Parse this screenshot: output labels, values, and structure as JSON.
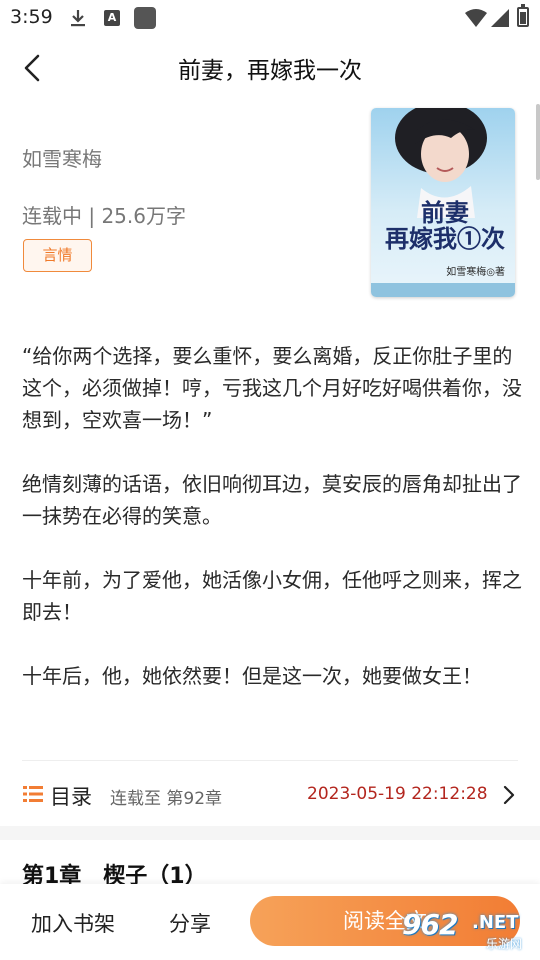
{
  "status_bar": {
    "time": "3:59",
    "icons": [
      "download-icon",
      "a-notification-icon",
      "app-square-icon",
      "wifi-icon",
      "signal-icon",
      "battery-icon"
    ]
  },
  "header": {
    "title": "前妻，再嫁我一次",
    "back_icon": "chevron-left-icon"
  },
  "book": {
    "author": "如雪寒梅",
    "status_line": "连载中 | 25.6万字",
    "genre_tag": "言情",
    "cover": {
      "title_line1": "前妻",
      "title_line2": "再嫁我①次",
      "author_credit": "如雪寒梅◎著"
    }
  },
  "synopsis": [
    "“给你两个选择，要么重怀，要么离婚，反正你肚子里的这个，必须做掉！哼，亏我这几个月好吃好喝供着你，没想到，空欢喜一场！”",
    "绝情刻薄的话语，依旧响彻耳边，莫安辰的唇角却扯出了一抹势在必得的笑意。",
    "十年前，为了爱他，她活像小女佣，任他呼之则来，挥之即去！",
    "十年后，他，她依然要！但是这一次，她要做女王！"
  ],
  "catalog": {
    "label": "目录",
    "progress": "连载至 第92章",
    "updated_at": "2023-05-19 22:12:28"
  },
  "chapter_preview": {
    "title": "第1章　楔子（1）"
  },
  "bottom_bar": {
    "add_shelf": "加入书架",
    "share": "分享",
    "read": "阅读全文"
  },
  "watermark": {
    "logo": "962",
    "net": ".NET",
    "sub": "乐游网"
  },
  "colors": {
    "accent_orange": "#f27d34",
    "tag_orange": "#f07a2a",
    "time_red": "#b3261e",
    "text_gray": "#777777"
  }
}
